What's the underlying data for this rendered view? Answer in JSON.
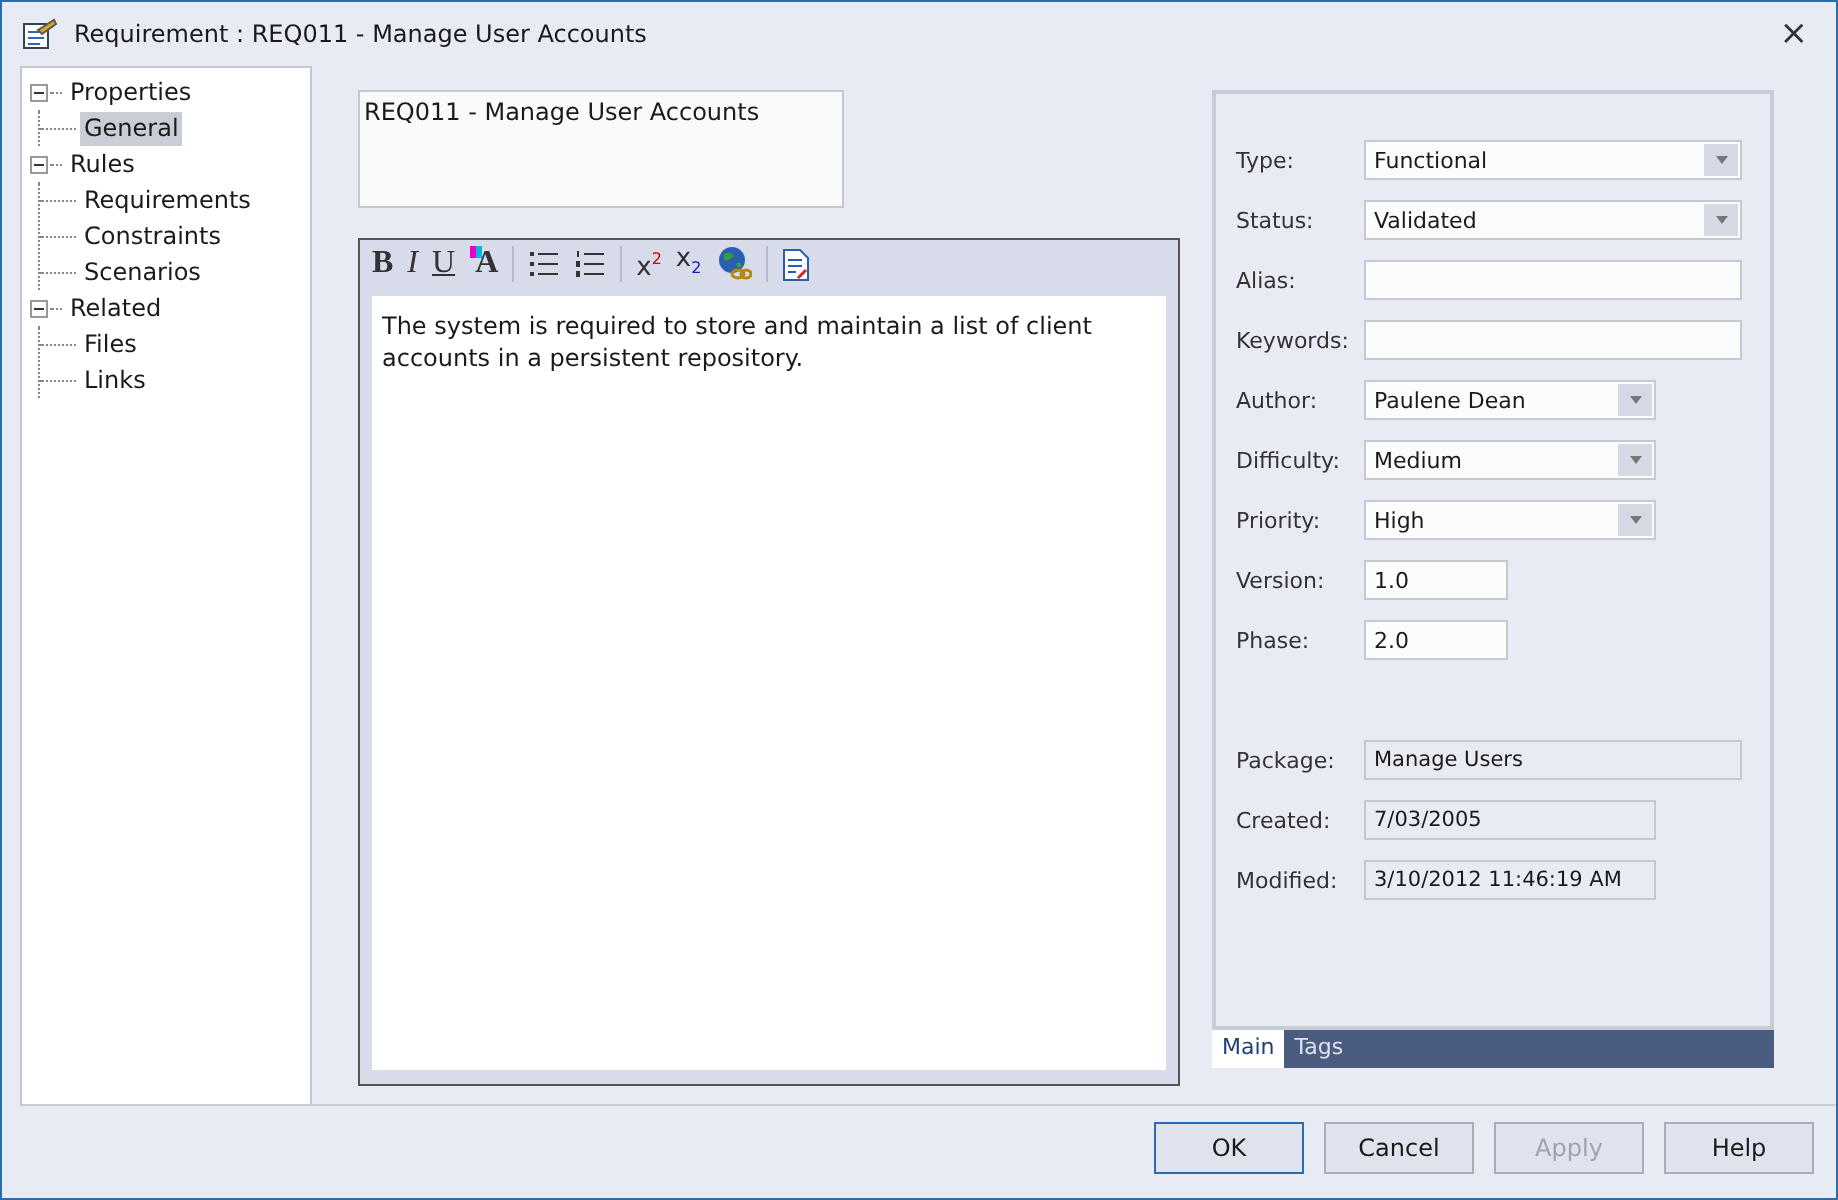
{
  "window": {
    "title": "Requirement : REQ011 - Manage User Accounts",
    "close": "×"
  },
  "tree": [
    {
      "label": "Properties",
      "expanded": true,
      "selected": false,
      "children": [
        {
          "label": "General",
          "selected": true
        }
      ]
    },
    {
      "label": "Rules",
      "expanded": true,
      "selected": false,
      "children": [
        {
          "label": "Requirements",
          "selected": false
        },
        {
          "label": "Constraints",
          "selected": false
        },
        {
          "label": "Scenarios",
          "selected": false
        }
      ]
    },
    {
      "label": "Related",
      "expanded": true,
      "selected": false,
      "children": [
        {
          "label": "Files",
          "selected": false
        },
        {
          "label": "Links",
          "selected": false
        }
      ]
    }
  ],
  "name_field": {
    "value": "REQ011 - Manage User Accounts"
  },
  "toolbar": [
    {
      "kind": "bold",
      "label": "B"
    },
    {
      "kind": "italic",
      "label": "I"
    },
    {
      "kind": "underline",
      "label": "U"
    },
    {
      "kind": "font-color",
      "label": "A"
    },
    {
      "kind": "bullets"
    },
    {
      "kind": "numbering"
    },
    {
      "kind": "superscript",
      "label": "x",
      "mark": "2"
    },
    {
      "kind": "subscript",
      "label": "x",
      "mark": "2"
    },
    {
      "kind": "hyperlink"
    },
    {
      "kind": "document"
    }
  ],
  "notes": "The system is required to store and maintain a list of client accounts in a persistent repository.",
  "fields": [
    {
      "label": "Type:",
      "kind": "dropdown",
      "value": "Functional"
    },
    {
      "label": "Status:",
      "kind": "dropdown",
      "value": "Validated"
    },
    {
      "label": "Alias:",
      "kind": "text"
    },
    {
      "label": "Keywords:",
      "kind": "text"
    },
    {
      "label": "Author:",
      "kind": "dropdown",
      "value": "Paulene Dean"
    },
    {
      "label": "Difficulty:",
      "kind": "dropdown",
      "value": "Medium"
    },
    {
      "label": "Priority:",
      "kind": "dropdown",
      "value": "High"
    },
    {
      "label": "Version:",
      "kind": "text",
      "value": "1.0"
    },
    {
      "label": "Phase:",
      "kind": "text",
      "value": "2.0"
    }
  ],
  "info_fields": [
    {
      "label": "Package:",
      "kind": "readonly",
      "value": "Manage Users"
    },
    {
      "label": "Created:",
      "kind": "readonly",
      "value": "7/03/2005"
    },
    {
      "label": "Modified:",
      "kind": "readonly",
      "value": "3/10/2012 11:46:19 AM"
    }
  ],
  "tabs": [
    {
      "label": "Main",
      "selected": true
    },
    {
      "label": "Tags",
      "selected": false
    }
  ],
  "buttons": [
    {
      "label": "OK",
      "default": true,
      "disabled": false
    },
    {
      "label": "Cancel",
      "default": false,
      "disabled": false
    },
    {
      "label": "Apply",
      "default": false,
      "disabled": true
    },
    {
      "label": "Help",
      "default": false,
      "disabled": false
    }
  ]
}
